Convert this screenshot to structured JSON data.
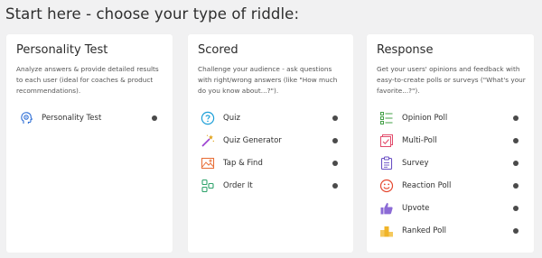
{
  "page_title": "Start here - choose your type of riddle:",
  "cards": [
    {
      "title": "Personality Test",
      "description": "Analyze answers & provide detailed results to each user (ideal for coaches & product recommendations).",
      "items": [
        {
          "label": "Personality Test",
          "icon": "head-gear-icon"
        }
      ]
    },
    {
      "title": "Scored",
      "description": "Challenge your audience - ask questions with right/wrong answers (like \"How much do you know about...?\").",
      "items": [
        {
          "label": "Quiz",
          "icon": "question-icon"
        },
        {
          "label": "Quiz Generator",
          "icon": "magic-wand-icon"
        },
        {
          "label": "Tap & Find",
          "icon": "image-tap-icon"
        },
        {
          "label": "Order It",
          "icon": "order-blocks-icon"
        }
      ]
    },
    {
      "title": "Response",
      "description": "Get your users' opinions and feedback with easy-to-create polls or surveys (\"What's your favorite...?\").",
      "items": [
        {
          "label": "Opinion Poll",
          "icon": "list-check-icon"
        },
        {
          "label": "Multi-Poll",
          "icon": "multi-check-icon"
        },
        {
          "label": "Survey",
          "icon": "clipboard-icon"
        },
        {
          "label": "Reaction Poll",
          "icon": "smiley-icon"
        },
        {
          "label": "Upvote",
          "icon": "thumbs-up-icon"
        },
        {
          "label": "Ranked Poll",
          "icon": "podium-icon"
        }
      ]
    }
  ]
}
